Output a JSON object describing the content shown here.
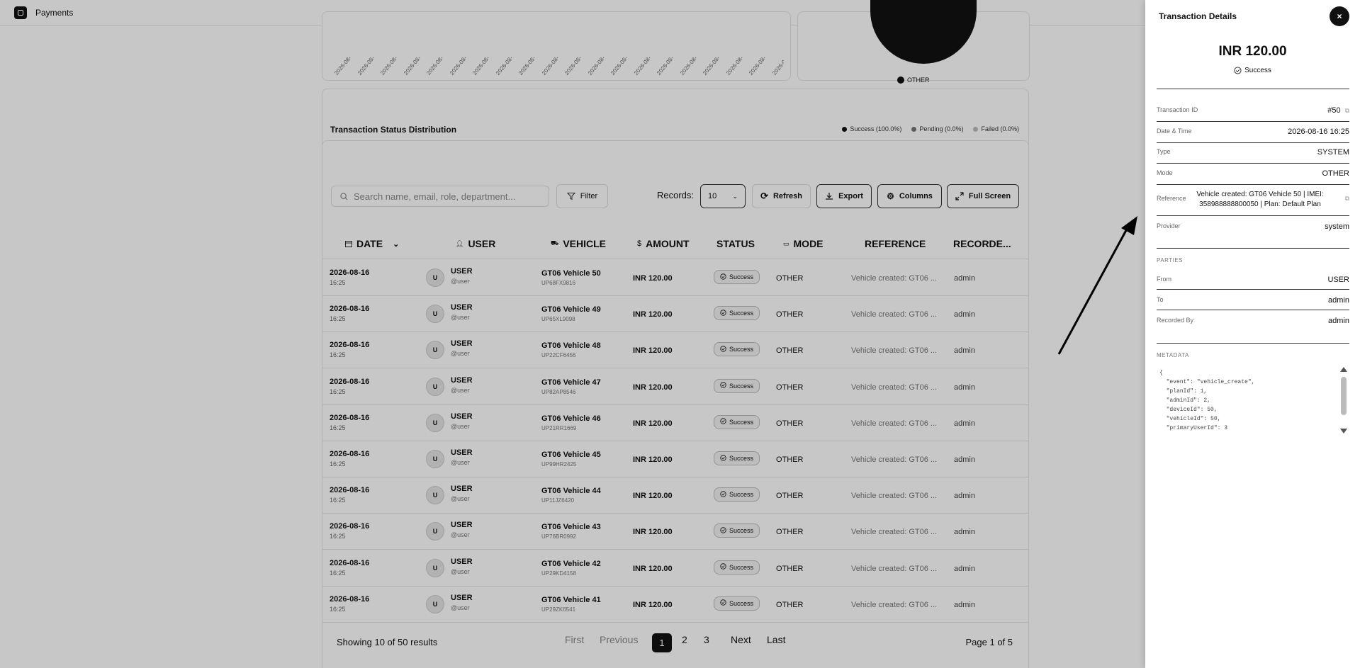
{
  "app": {
    "title": "Payments"
  },
  "top_chart": {
    "tick_labels": [
      "2026-08-",
      "2026-08-",
      "2026-08-",
      "2026-08-",
      "2026-08-",
      "2026-08-",
      "2026-08-",
      "2026-08-",
      "2026-08-",
      "2026-08-",
      "2026-08-",
      "2026-08-",
      "2026-08-",
      "2026-08-",
      "2026-08-",
      "2026-08-",
      "2026-08-",
      "2026-08-",
      "2026-08-",
      "2026-08-",
      "2026-08-"
    ],
    "pie_legend": "OTHER"
  },
  "status_distribution": {
    "title": "Transaction Status Distribution",
    "legend": [
      {
        "label": "Success (100.0%)",
        "color": "#111111"
      },
      {
        "label": "Pending (0.0%)",
        "color": "#777777"
      },
      {
        "label": "Failed (0.0%)",
        "color": "#bbbbbb"
      }
    ],
    "success_fraction": 1.0
  },
  "toolbar": {
    "search_placeholder": "Search name, email, role, department...",
    "filter": "Filter",
    "records_label": "Records:",
    "records_value": "10",
    "refresh": "Refresh",
    "export": "Export",
    "columns": "Columns",
    "fullscreen": "Full Screen"
  },
  "table": {
    "headers": {
      "date": "DATE",
      "user": "USER",
      "vehicle": "VEHICLE",
      "amount": "AMOUNT",
      "status": "STATUS",
      "mode": "MODE",
      "reference": "REFERENCE",
      "recorded": "RECORDE..."
    },
    "rows": [
      {
        "date": "2026-08-16",
        "time": "16:25",
        "avatar": "U",
        "user": "USER",
        "handle": "@user",
        "vehicle": "GT06 Vehicle 50",
        "plate": "UP68FX9816",
        "amount": "INR 120.00",
        "status": "Success",
        "mode": "OTHER",
        "reference": "Vehicle created: GT06 ...",
        "recorded": "admin"
      },
      {
        "date": "2026-08-16",
        "time": "16:25",
        "avatar": "U",
        "user": "USER",
        "handle": "@user",
        "vehicle": "GT06 Vehicle 49",
        "plate": "UP65XL9098",
        "amount": "INR 120.00",
        "status": "Success",
        "mode": "OTHER",
        "reference": "Vehicle created: GT06 ...",
        "recorded": "admin"
      },
      {
        "date": "2026-08-16",
        "time": "16:25",
        "avatar": "U",
        "user": "USER",
        "handle": "@user",
        "vehicle": "GT06 Vehicle 48",
        "plate": "UP22CF6456",
        "amount": "INR 120.00",
        "status": "Success",
        "mode": "OTHER",
        "reference": "Vehicle created: GT06 ...",
        "recorded": "admin"
      },
      {
        "date": "2026-08-16",
        "time": "16:25",
        "avatar": "U",
        "user": "USER",
        "handle": "@user",
        "vehicle": "GT06 Vehicle 47",
        "plate": "UP82AP8546",
        "amount": "INR 120.00",
        "status": "Success",
        "mode": "OTHER",
        "reference": "Vehicle created: GT06 ...",
        "recorded": "admin"
      },
      {
        "date": "2026-08-16",
        "time": "16:25",
        "avatar": "U",
        "user": "USER",
        "handle": "@user",
        "vehicle": "GT06 Vehicle 46",
        "plate": "UP21RR1669",
        "amount": "INR 120.00",
        "status": "Success",
        "mode": "OTHER",
        "reference": "Vehicle created: GT06 ...",
        "recorded": "admin"
      },
      {
        "date": "2026-08-16",
        "time": "16:25",
        "avatar": "U",
        "user": "USER",
        "handle": "@user",
        "vehicle": "GT06 Vehicle 45",
        "plate": "UP99HR2425",
        "amount": "INR 120.00",
        "status": "Success",
        "mode": "OTHER",
        "reference": "Vehicle created: GT06 ...",
        "recorded": "admin"
      },
      {
        "date": "2026-08-16",
        "time": "16:25",
        "avatar": "U",
        "user": "USER",
        "handle": "@user",
        "vehicle": "GT06 Vehicle 44",
        "plate": "UP11JZ6420",
        "amount": "INR 120.00",
        "status": "Success",
        "mode": "OTHER",
        "reference": "Vehicle created: GT06 ...",
        "recorded": "admin"
      },
      {
        "date": "2026-08-16",
        "time": "16:25",
        "avatar": "U",
        "user": "USER",
        "handle": "@user",
        "vehicle": "GT06 Vehicle 43",
        "plate": "UP76BR0992",
        "amount": "INR 120.00",
        "status": "Success",
        "mode": "OTHER",
        "reference": "Vehicle created: GT06 ...",
        "recorded": "admin"
      },
      {
        "date": "2026-08-16",
        "time": "16:25",
        "avatar": "U",
        "user": "USER",
        "handle": "@user",
        "vehicle": "GT06 Vehicle 42",
        "plate": "UP29KD4158",
        "amount": "INR 120.00",
        "status": "Success",
        "mode": "OTHER",
        "reference": "Vehicle created: GT06 ...",
        "recorded": "admin"
      },
      {
        "date": "2026-08-16",
        "time": "16:25",
        "avatar": "U",
        "user": "USER",
        "handle": "@user",
        "vehicle": "GT06 Vehicle 41",
        "plate": "UP29ZK6541",
        "amount": "INR 120.00",
        "status": "Success",
        "mode": "OTHER",
        "reference": "Vehicle created: GT06 ...",
        "recorded": "admin"
      }
    ]
  },
  "pagination": {
    "showing": "Showing 10 of 50 results",
    "first": "First",
    "previous": "Previous",
    "pages": [
      "1",
      "2",
      "3"
    ],
    "next": "Next",
    "last": "Last",
    "page_info": "Page 1 of 5"
  },
  "drawer": {
    "title": "Transaction Details",
    "close": "×",
    "amount": "INR 120.00",
    "status": "Success",
    "fields": {
      "transaction_id": {
        "label": "Transaction ID",
        "value": "#50"
      },
      "date_time": {
        "label": "Date & Time",
        "value": "2026-08-16 16:25"
      },
      "type": {
        "label": "Type",
        "value": "SYSTEM"
      },
      "mode": {
        "label": "Mode",
        "value": "OTHER"
      },
      "reference": {
        "label": "Reference",
        "value": "Vehicle created: GT06 Vehicle 50 | IMEI: 358988888800050 | Plan: Default Plan"
      },
      "provider": {
        "label": "Provider",
        "value": "system"
      }
    },
    "parties": {
      "section": "PARTIES",
      "from": {
        "label": "From",
        "value": "USER"
      },
      "to": {
        "label": "To",
        "value": "admin"
      },
      "recorded_by": {
        "label": "Recorded By",
        "value": "admin"
      }
    },
    "metadata": {
      "section": "METADATA",
      "json": "{\n  \"event\": \"vehicle_create\",\n  \"planId\": 1,\n  \"adminId\": 2,\n  \"deviceId\": 50,\n  \"vehicleId\": 50,\n  \"primaryUserId\": 3"
    }
  }
}
